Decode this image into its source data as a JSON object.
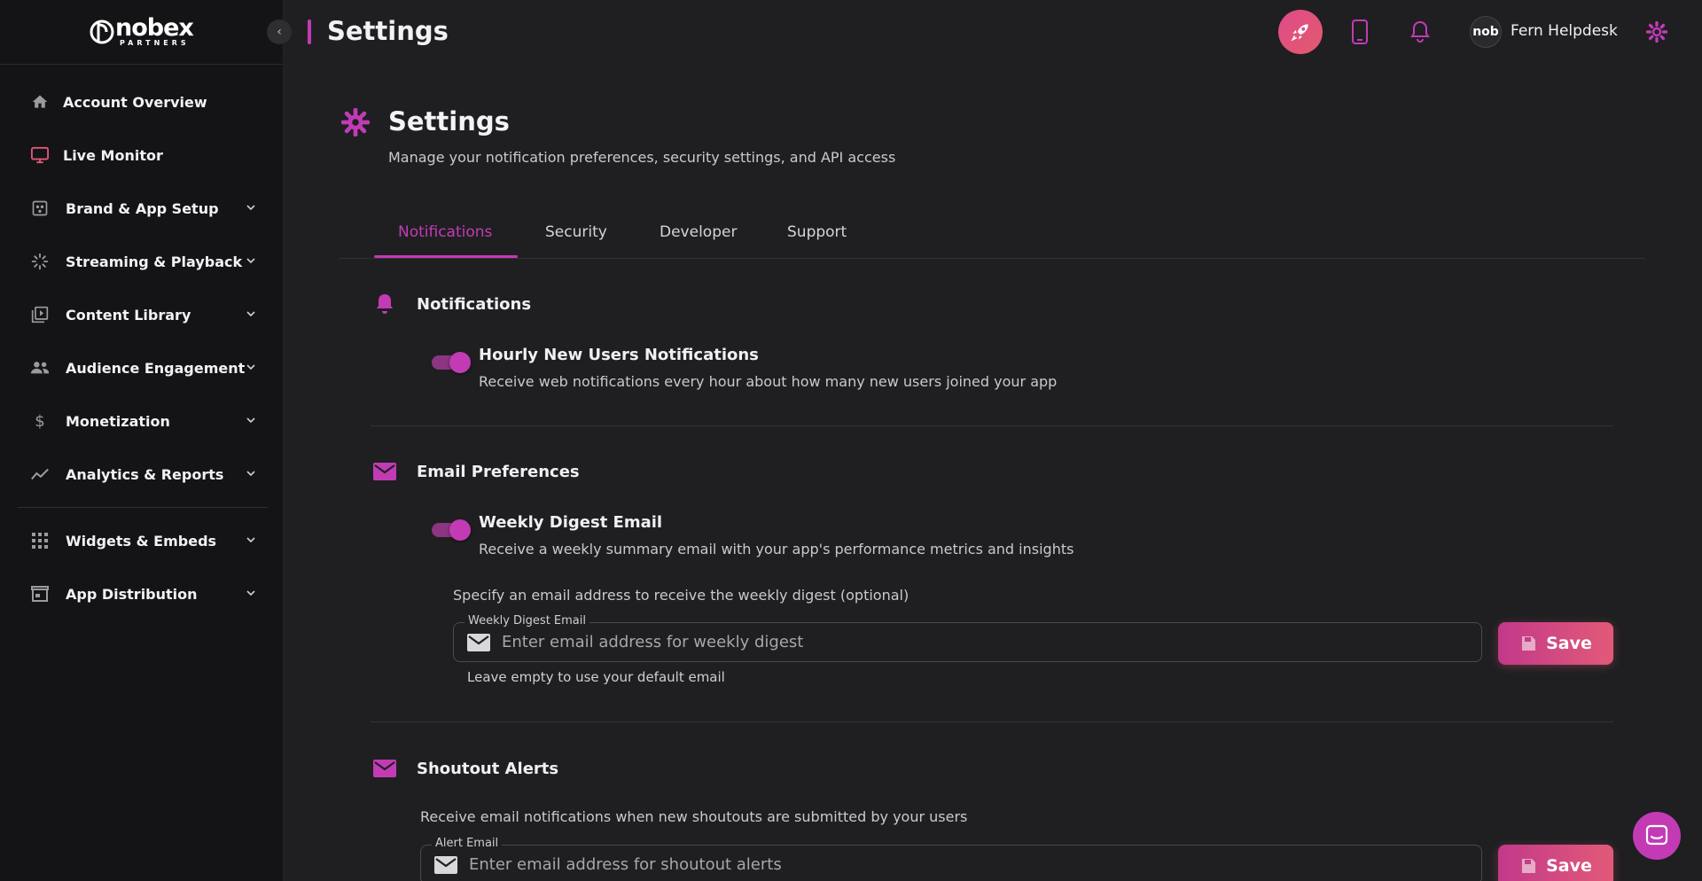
{
  "brand": {
    "logo_text": "nobex",
    "logo_sub": "PARTNERS"
  },
  "sidebar": {
    "items": [
      {
        "label": "Account Overview",
        "icon": "home-icon"
      },
      {
        "label": "Live Monitor",
        "icon": "monitor-icon"
      },
      {
        "label": "Brand & App Setup",
        "icon": "palette-icon"
      },
      {
        "label": "Streaming & Playback",
        "icon": "streaming-icon"
      },
      {
        "label": "Content Library",
        "icon": "library-icon"
      },
      {
        "label": "Audience Engagement",
        "icon": "people-icon"
      },
      {
        "label": "Monetization",
        "icon": "dollar-icon"
      },
      {
        "label": "Analytics & Reports",
        "icon": "chart-icon"
      },
      {
        "label": "Widgets & Embeds",
        "icon": "grid-icon"
      },
      {
        "label": "App Distribution",
        "icon": "store-icon"
      }
    ]
  },
  "topbar": {
    "title": "Settings",
    "user_name": "Fern Helpdesk",
    "avatar_text": "nob"
  },
  "page": {
    "title": "Settings",
    "subtitle": "Manage your notification preferences, security settings, and API access"
  },
  "tabs": [
    "Notifications",
    "Security",
    "Developer",
    "Support"
  ],
  "notifications": {
    "title": "Notifications",
    "option_title": "Hourly New Users Notifications",
    "option_desc": "Receive web notifications every hour about how many new users joined your app",
    "enabled": true
  },
  "email_prefs": {
    "title": "Email Preferences",
    "option_title": "Weekly Digest Email",
    "option_desc": "Receive a weekly summary email with your app's performance metrics and insights",
    "enabled": true,
    "specify_text": "Specify an email address to receive the weekly digest (optional)",
    "field_label": "Weekly Digest Email",
    "placeholder": "Enter email address for weekly digest",
    "helper": "Leave empty to use your default email",
    "save_label": "Save"
  },
  "shoutout": {
    "title": "Shoutout Alerts",
    "desc": "Receive email notifications when new shoutouts are submitted by your users",
    "field_label": "Alert Email",
    "placeholder": "Enter email address for shoutout alerts",
    "save_label": "Save"
  },
  "colors": {
    "accent": "#c23bb5",
    "button_gradient_start": "#c2398a",
    "button_gradient_end": "#e25a78"
  }
}
